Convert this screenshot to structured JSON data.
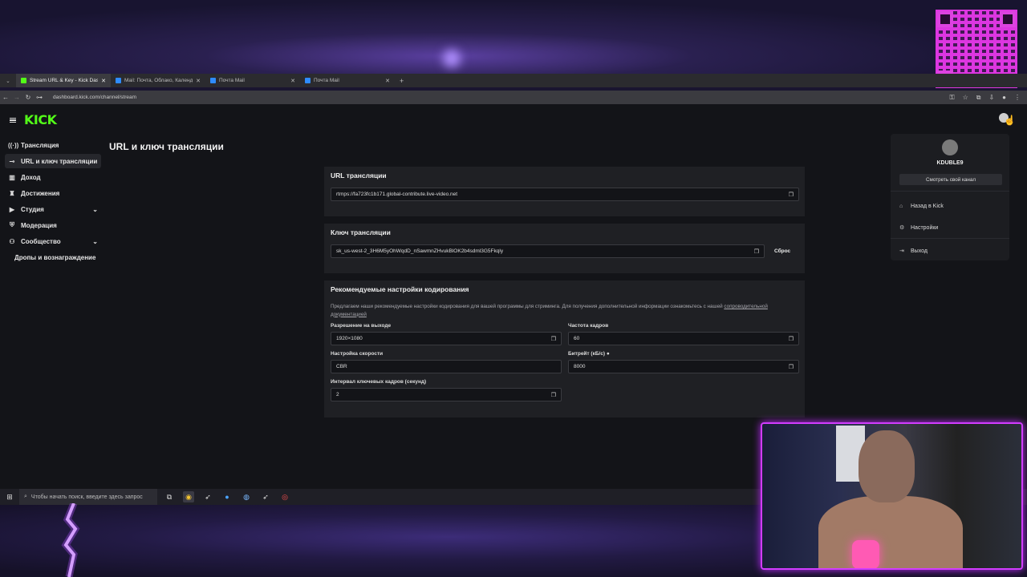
{
  "browser": {
    "tabs": [
      {
        "label": "Stream URL & Key - Kick Dashb",
        "favicon_color": "#53fc18"
      },
      {
        "label": "Mail: Почта, Облако, Календар",
        "favicon_color": "#2f8cff"
      },
      {
        "label": "Почта Mail",
        "favicon_color": "#2f8cff"
      },
      {
        "label": "Почта Mail",
        "favicon_color": "#2f8cff"
      }
    ],
    "url": "dashboard.kick.com/channel/stream"
  },
  "logo": "KICK",
  "sidebar": {
    "items": [
      {
        "label": "Трансляция",
        "icon": "broadcast-icon"
      },
      {
        "label": "URL и ключ трансляции",
        "icon": "link-icon"
      },
      {
        "label": "Доход",
        "icon": "chart-icon"
      },
      {
        "label": "Достижения",
        "icon": "trophy-icon"
      },
      {
        "label": "Студия",
        "icon": "video-icon"
      },
      {
        "label": "Модерация",
        "icon": "shield-icon"
      },
      {
        "label": "Сообщество",
        "icon": "community-icon"
      },
      {
        "label": "Дропы и вознаграждение",
        "icon": ""
      }
    ]
  },
  "page_title": "URL и ключ трансляции",
  "stream_url": {
    "title": "URL трансляции",
    "value": "rtmps://fa723fc1b171.global-contribute.live-video.net"
  },
  "stream_key": {
    "title": "Ключ трансляции",
    "value": "sk_us-west-2_3H6M5yOhWqdD_nSawmnZHvukBlOK2b4sdml3G5Fkqly",
    "reset_label": "Сброс"
  },
  "encoding": {
    "title": "Рекомендуемые настройки кодирования",
    "description": "Предлагаем наши рекомендуемые настройки кодирования для вашей программы для стриминга. Для получения дополнительной информации ознакомьтесь с нашей",
    "doc_link": "сопроводительной документацией",
    "output_resolution": {
      "label": "Разрешение на выходе",
      "value": "1920×1080"
    },
    "framerate": {
      "label": "Частота кадров",
      "value": "60"
    },
    "rate_control": {
      "label": "Настройка скорости",
      "value": "CBR"
    },
    "bitrate": {
      "label": "Битрейт (кБ/с)",
      "value": "8000"
    },
    "keyframe_interval": {
      "label": "Интервал ключевых кадров (секунд)",
      "value": "2"
    }
  },
  "profile_menu": {
    "username": "KDUBLE9",
    "view_channel_label": "Смотреть свой канал",
    "items": [
      {
        "label": "Назад в Kick",
        "icon": "home-icon"
      },
      {
        "label": "Настройки",
        "icon": "gear-icon"
      },
      {
        "label": "Выход",
        "icon": "logout-icon"
      }
    ]
  },
  "taskbar": {
    "search_placeholder": "Чтобы начать поиск, введите здесь запрос"
  },
  "colors": {
    "kick_green": "#53fc18",
    "webcam_border": "#d23cff"
  }
}
